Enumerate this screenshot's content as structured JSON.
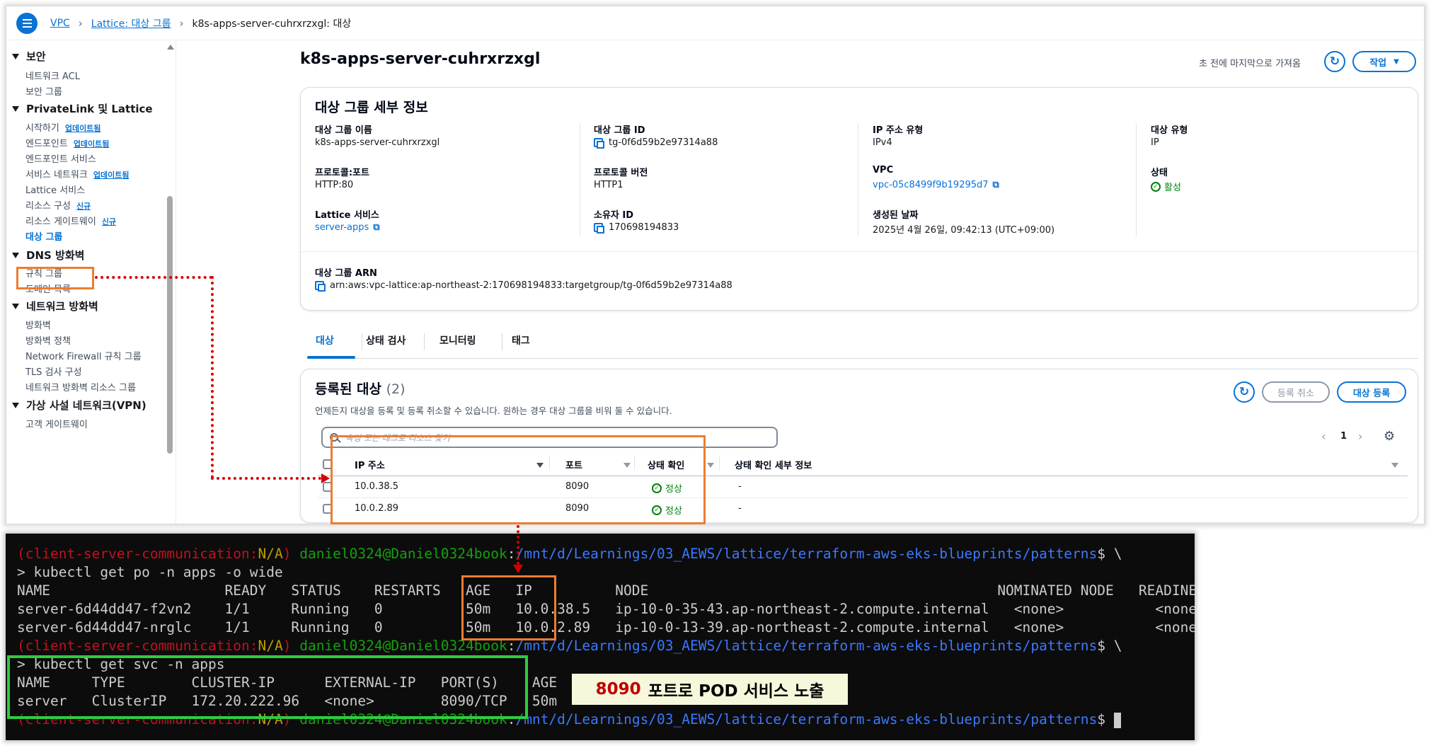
{
  "breadcrumb": [
    "VPC",
    "Lattice: 대상 그룹",
    "k8s-apps-server-cuhrxrzxgl: 대상"
  ],
  "sidebar": {
    "sections": [
      {
        "title": "보안",
        "items": [
          {
            "label": "네트워크 ACL"
          },
          {
            "label": "보안 그룹"
          }
        ]
      },
      {
        "title": "PrivateLink 및 Lattice",
        "items": [
          {
            "label": "시작하기",
            "badge": "업데이트됨"
          },
          {
            "label": "엔드포인트",
            "badge": "업데이트됨"
          },
          {
            "label": "엔드포인트 서비스"
          },
          {
            "label": "서비스 네트워크",
            "badge": "업데이트됨"
          },
          {
            "label": "Lattice 서비스"
          },
          {
            "label": "리소스 구성",
            "badge": "신규"
          },
          {
            "label": "리소스 게이트웨이",
            "badge": "신규"
          },
          {
            "label": "대상 그룹",
            "active": true
          }
        ]
      },
      {
        "title": "DNS 방화벽",
        "items": [
          {
            "label": "규칙 그룹"
          },
          {
            "label": "도메인 목록"
          }
        ]
      },
      {
        "title": "네트워크 방화벽",
        "items": [
          {
            "label": "방화벽"
          },
          {
            "label": "방화벽 정책"
          },
          {
            "label": "Network Firewall 규칙 그룹"
          },
          {
            "label": "TLS 검사 구성"
          },
          {
            "label": "네트워크 방화벽 리소스 그룹"
          }
        ]
      },
      {
        "title": "가상 사설 네트워크(VPN)",
        "items": [
          {
            "label": "고객 게이트웨이"
          }
        ]
      }
    ]
  },
  "header": {
    "title": "k8s-apps-server-cuhrxrzxgl",
    "last_fetched": "초 전에 마지막으로 가져옴",
    "actions_label": "작업"
  },
  "details": {
    "title": "대상 그룹 세부 정보",
    "fields": {
      "name_label": "대상 그룹 이름",
      "name": "k8s-apps-server-cuhrxrzxgl",
      "id_label": "대상 그룹 ID",
      "id": "tg-0f6d59b2e97314a88",
      "ip_type_label": "IP 주소 유형",
      "ip_type": "IPv4",
      "target_type_label": "대상 유형",
      "target_type": "IP",
      "protocol_port_label": "프로토콜:포트",
      "protocol_port": "HTTP:80",
      "protocol_version_label": "프로토콜 버전",
      "protocol_version": "HTTP1",
      "vpc_label": "VPC",
      "vpc": "vpc-05c8499f9b19295d7",
      "status_label": "상태",
      "status": "활성",
      "lattice_service_label": "Lattice 서비스",
      "lattice_service": "server-apps",
      "owner_label": "소유자 ID",
      "owner": "170698194833",
      "created_label": "생성된 날짜",
      "created": "2025년 4월 26일, 09:42:13 (UTC+09:00)",
      "arn_label": "대상 그룹 ARN",
      "arn": "arn:aws:vpc-lattice:ap-northeast-2:170698194833:targetgroup/tg-0f6d59b2e97314a88"
    }
  },
  "tabs": [
    "대상",
    "상태 검사",
    "모니터링",
    "태그"
  ],
  "targets": {
    "title": "등록된 대상",
    "count": "(2)",
    "description": "언제든지 대상을 등록 및 등록 취소할 수 있습니다. 원하는 경우 대상 그룹을 비워 둘 수 있습니다.",
    "deregister_label": "등록 취소",
    "register_label": "대상 등록",
    "search_placeholder": "속성 또는 태그로 리소스 찾기",
    "page": "1",
    "columns": [
      "IP 주소",
      "포트",
      "상태 확인",
      "상태 확인 세부 정보"
    ],
    "rows": [
      {
        "ip": "10.0.38.5",
        "port": "8090",
        "health": "정상",
        "details": "-"
      },
      {
        "ip": "10.0.2.89",
        "port": "8090",
        "health": "정상",
        "details": "-"
      }
    ]
  },
  "terminal": {
    "prompt_env": "client-server-communication",
    "prompt_na": "N/A",
    "prompt_user": "daniel0324@Daniel0324book",
    "prompt_path": "/mnt/d/Learnings/03_AEWS/lattice/terraform-aws-eks-blueprints/patterns",
    "cmd1": "> kubectl get po -n apps -o wide",
    "pod_header": "NAME                     READY   STATUS    RESTARTS   AGE   IP          NODE                                          NOMINATED NODE   READINESS GATES",
    "pod_row1": "server-6d44dd47-f2vn2    1/1     Running   0          50m   10.0.38.5   ip-10-0-35-43.ap-northeast-2.compute.internal   <none>           <none>",
    "pod_row2": "server-6d44dd47-nrglc    1/1     Running   0          50m   10.0.2.89   ip-10-0-13-39.ap-northeast-2.compute.internal   <none>           <none>",
    "cmd2": "> kubectl get svc -n apps",
    "svc_header": "NAME     TYPE        CLUSTER-IP      EXTERNAL-IP   PORT(S)    AGE",
    "svc_row": "server   ClusterIP   172.20.222.96   <none>        8090/TCP   50m"
  },
  "annotation": {
    "number": "8090",
    "text": "포트로 POD 서비스 노출"
  }
}
